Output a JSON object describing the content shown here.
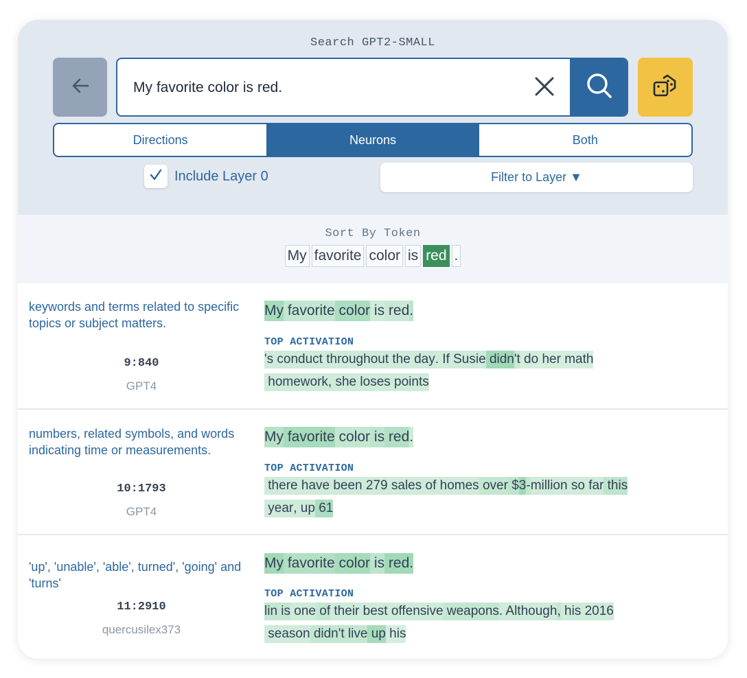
{
  "header": {
    "search_title": "Search GPT2-SMALL",
    "search_value": "My favorite color is red."
  },
  "icons": {
    "back": "arrow-left-icon",
    "clear": "close-icon",
    "search": "search-icon",
    "random": "dice-icon",
    "check": "check-icon",
    "dropdown": "triangle-down-icon"
  },
  "colors": {
    "primary": "#2c67a0",
    "accent": "#f2c245",
    "back_button": "#94a3b8",
    "selected_token": "#3b8f5b"
  },
  "tabs": [
    "Directions",
    "Neurons",
    "Both"
  ],
  "active_tab": "Neurons",
  "include_layer0": {
    "label": "Include Layer 0",
    "checked": true
  },
  "filter": {
    "label": "Filter to Layer ▼"
  },
  "sort": {
    "title": "Sort By Token",
    "tokens": [
      "My",
      "favorite",
      "color",
      "is",
      "red",
      "."
    ],
    "selected": "red"
  },
  "results": [
    {
      "description": "keywords and terms related to specific topics or subject matters.",
      "id": "9:840",
      "source": "GPT4",
      "sentence": [
        {
          "t": "My",
          "a": 0.55
        },
        {
          "t": " favorite",
          "a": 0.3
        },
        {
          "t": " color",
          "a": 0.5
        },
        {
          "t": " is",
          "a": 0.2
        },
        {
          "t": " red",
          "a": 0.25
        },
        {
          "t": ".",
          "a": 0.35
        }
      ],
      "top_label": "TOP ACTIVATION",
      "top_activation": [
        [
          {
            "t": "'s",
            "a": 0.2
          },
          {
            "t": " conduct",
            "a": 0.2
          },
          {
            "t": " throughout",
            "a": 0.2
          },
          {
            "t": " the",
            "a": 0.2
          },
          {
            "t": " day",
            "a": 0.2
          },
          {
            "t": ".",
            "a": 0.2
          },
          {
            "t": " If",
            "a": 0.2
          },
          {
            "t": " Susie",
            "a": 0.2
          },
          {
            "t": " didn",
            "a": 0.6
          },
          {
            "t": "'t",
            "a": 0.25
          },
          {
            "t": " do",
            "a": 0.15
          },
          {
            "t": " her",
            "a": 0.15
          },
          {
            "t": " math",
            "a": 0.15
          }
        ],
        [
          {
            "t": " homework",
            "a": 0.2
          },
          {
            "t": ",",
            "a": 0.2
          },
          {
            "t": " she",
            "a": 0.2
          },
          {
            "t": " loses",
            "a": 0.2
          },
          {
            "t": " points",
            "a": 0.2
          }
        ]
      ]
    },
    {
      "description": "numbers, related symbols, and words indicating time or measurements.",
      "id": "10:1793",
      "source": "GPT4",
      "sentence": [
        {
          "t": "My",
          "a": 0.4
        },
        {
          "t": " favorite",
          "a": 0.55
        },
        {
          "t": " color",
          "a": 0.3
        },
        {
          "t": " is",
          "a": 0.35
        },
        {
          "t": " red",
          "a": 0.45
        },
        {
          "t": ".",
          "a": 0.2
        }
      ],
      "top_label": "TOP ACTIVATION",
      "top_activation": [
        [
          {
            "t": " there",
            "a": 0.2
          },
          {
            "t": " have",
            "a": 0.2
          },
          {
            "t": " been",
            "a": 0.2
          },
          {
            "t": " 279",
            "a": 0.2
          },
          {
            "t": " sales",
            "a": 0.2
          },
          {
            "t": " of",
            "a": 0.2
          },
          {
            "t": " homes",
            "a": 0.2
          },
          {
            "t": " over",
            "a": 0.3
          },
          {
            "t": " $",
            "a": 0.35
          },
          {
            "t": "3",
            "a": 0.6
          },
          {
            "t": "-",
            "a": 0.3
          },
          {
            "t": "million",
            "a": 0.2
          },
          {
            "t": " so",
            "a": 0.2
          },
          {
            "t": " far",
            "a": 0.2
          },
          {
            "t": " this",
            "a": 0.35
          }
        ],
        [
          {
            "t": " year",
            "a": 0.2
          },
          {
            "t": ",",
            "a": 0.2
          },
          {
            "t": " up",
            "a": 0.2
          },
          {
            "t": " 61",
            "a": 0.5
          }
        ]
      ]
    },
    {
      "description": "'up', 'unable', 'able', turned', 'going' and 'turns'",
      "id": "11:2910",
      "source": "quercusilex373",
      "sentence": [
        {
          "t": "My",
          "a": 0.6
        },
        {
          "t": " favorite",
          "a": 0.45
        },
        {
          "t": " color",
          "a": 0.55
        },
        {
          "t": " is",
          "a": 0.35
        },
        {
          "t": " red",
          "a": 0.6
        },
        {
          "t": ".",
          "a": 0.6
        }
      ],
      "top_label": "TOP ACTIVATION",
      "top_activation": [
        [
          {
            "t": "lin",
            "a": 0.3
          },
          {
            "t": " is",
            "a": 0.3
          },
          {
            "t": " one",
            "a": 0.2
          },
          {
            "t": " of",
            "a": 0.3
          },
          {
            "t": " their",
            "a": 0.2
          },
          {
            "t": " best",
            "a": 0.2
          },
          {
            "t": " offensive",
            "a": 0.2
          },
          {
            "t": " weapons",
            "a": 0.3
          },
          {
            "t": ".",
            "a": 0.2
          },
          {
            "t": " Although",
            "a": 0.2
          },
          {
            "t": ",",
            "a": 0.3
          },
          {
            "t": " his",
            "a": 0.2
          },
          {
            "t": " 2016",
            "a": 0.2
          }
        ],
        [
          {
            "t": " season",
            "a": 0.2
          },
          {
            "t": " didn",
            "a": 0.3
          },
          {
            "t": "'t",
            "a": 0.3
          },
          {
            "t": " live",
            "a": 0.3
          },
          {
            "t": " up",
            "a": 0.55
          },
          {
            "t": " his",
            "a": 0.15
          }
        ]
      ]
    }
  ]
}
